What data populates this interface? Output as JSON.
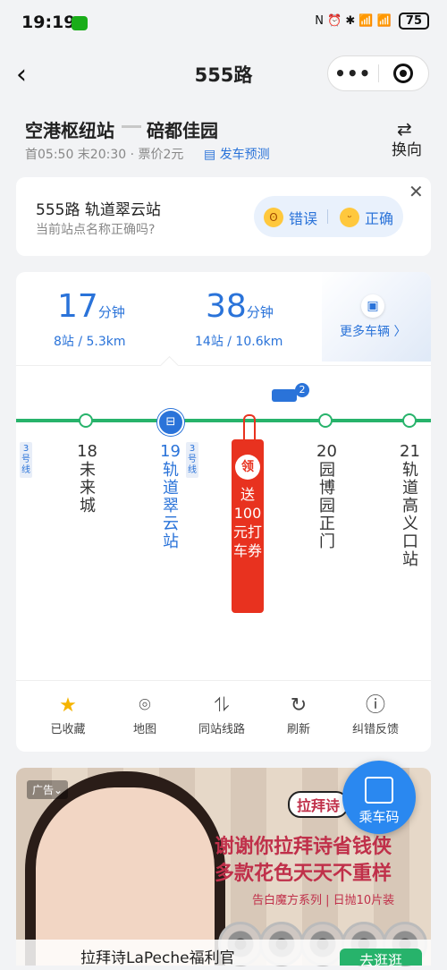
{
  "status": {
    "time": "19:19",
    "battery": "75",
    "icons": "N ⏰ ✱ 📶 📶"
  },
  "nav": {
    "title": "555路"
  },
  "route": {
    "from": "空港枢纽站",
    "to": "碚都佳园",
    "info": "首05:50 末20:30 · 票价2元",
    "predict": "发车预测",
    "swap_label": "换向"
  },
  "question": {
    "title": "555路 轨道翠云站",
    "subtitle": "当前站点名称正确吗?",
    "wrong": "错误",
    "right": "正确"
  },
  "eta": [
    {
      "minutes": "17",
      "unit": "分钟",
      "detail": "8站 / 5.3km"
    },
    {
      "minutes": "38",
      "unit": "分钟",
      "detail": "14站 / 10.6km"
    }
  ],
  "more_buses": "更多车辆 〉",
  "bus_count": "2",
  "stations": [
    {
      "num": "18",
      "name": "未来城"
    },
    {
      "num": "19",
      "name": "轨道翠云站"
    },
    {
      "num": "20",
      "name": "园博园正门"
    },
    {
      "num": "21",
      "name": "轨道高义口站"
    }
  ],
  "line_tags": {
    "t1": "3号线",
    "t2": "3号线"
  },
  "current_badge": "⊟",
  "coupon": {
    "circle": "领",
    "text": "送100元打车券"
  },
  "tools": [
    {
      "label": "已收藏",
      "icon": "star-icon"
    },
    {
      "label": "地图",
      "icon": "map-pin-icon"
    },
    {
      "label": "同站线路",
      "icon": "routes-icon"
    },
    {
      "label": "刷新",
      "icon": "refresh-icon"
    },
    {
      "label": "纠错反馈",
      "icon": "help-icon"
    }
  ],
  "ad": {
    "tag": "广告",
    "brand": "拉拜诗",
    "headline1": "谢谢你拉拜诗省钱侠",
    "headline2": "多款花色天天不重样",
    "sub": "告白魔方系列 | 日抛10片装",
    "bottom_text": "拉拜诗LaPeche福利官",
    "cta": "去逛逛"
  },
  "ride_code": "乘车码",
  "colors": {
    "accent": "#2a73d9",
    "line": "#27b36b",
    "coupon": "#e8321f"
  }
}
